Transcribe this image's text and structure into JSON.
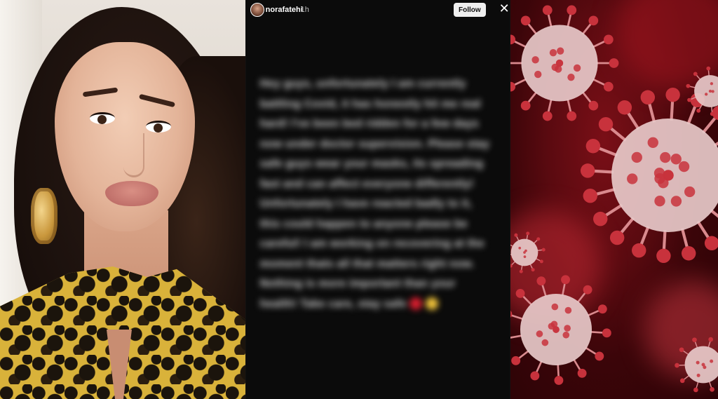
{
  "story": {
    "username": "norafatehi",
    "timestamp": "1h",
    "follow_label": "Follow",
    "close_glyph": "✕",
    "text": "Hey guys, unfortunately I am currently battling Covid, it has honestly hit me real hard! I've been bed ridden for a few days now under doctor supervision. Please stay safe guys wear your masks, its spreading fast and can affect everyone differently! Unfortunately I have reacted badly to it, this could happen to anyone please be careful! I am working on recovering at the moment thats all that matters right now. Nothing is more important than your health! Take care, stay safe"
  },
  "colors": {
    "story_background": "#0b0b0b",
    "follow_button": "#efefef",
    "virus_red": "#c8323c",
    "virus_body": "#e7c9c9"
  },
  "icons": {
    "close": "close-icon",
    "avatar": "profile-avatar-icon"
  }
}
